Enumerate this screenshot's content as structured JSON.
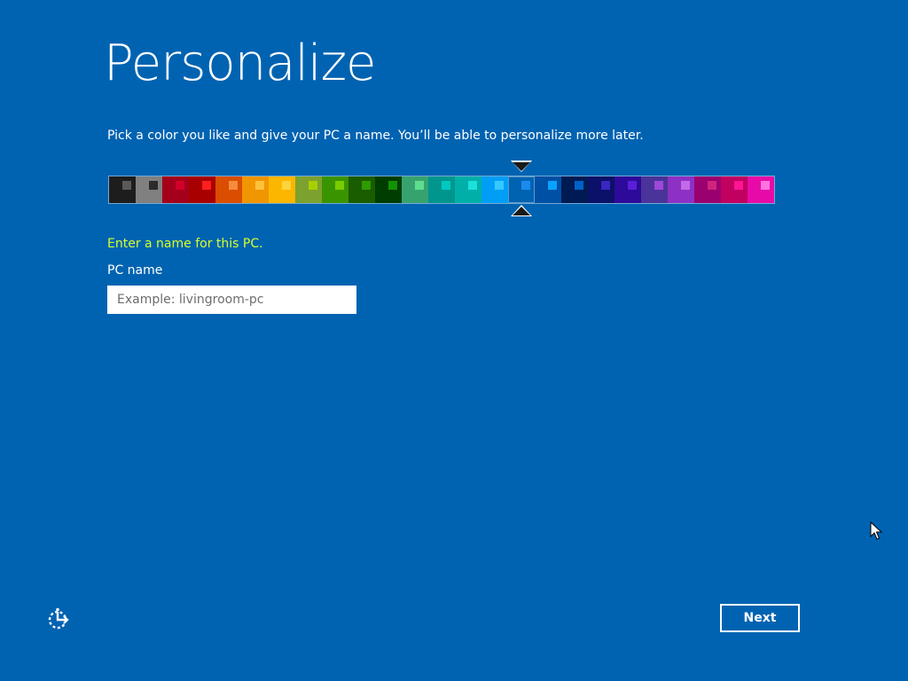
{
  "page": {
    "title": "Personalize",
    "subtitle": "Pick a color you like and give your PC a name. You’ll be able to personalize more later.",
    "background_color": "#0063b1"
  },
  "color_picker": {
    "selected_index": 15,
    "swatches": [
      {
        "bg": "#1d1d1d",
        "chip": "#5a5a5a"
      },
      {
        "bg": "#808080",
        "chip": "#2b2b2b"
      },
      {
        "bg": "#a4001b",
        "chip": "#d1002a"
      },
      {
        "bg": "#a80000",
        "chip": "#ff1f1f"
      },
      {
        "bg": "#d94e00",
        "chip": "#f68b3d"
      },
      {
        "bg": "#f09600",
        "chip": "#fcc23b"
      },
      {
        "bg": "#fbb600",
        "chip": "#fcd43b"
      },
      {
        "bg": "#7da12e",
        "chip": "#a7cf00"
      },
      {
        "bg": "#3a9400",
        "chip": "#78cc00"
      },
      {
        "bg": "#1a5c00",
        "chip": "#2f9b00"
      },
      {
        "bg": "#003d00",
        "chip": "#119400"
      },
      {
        "bg": "#36a36f",
        "chip": "#5fde8f"
      },
      {
        "bg": "#00968d",
        "chip": "#00c9c2"
      },
      {
        "bg": "#00b0a8",
        "chip": "#1ee0da"
      },
      {
        "bg": "#019ef6",
        "chip": "#38c8ff"
      },
      {
        "bg": "#0063b1",
        "chip": "#1a8cee"
      },
      {
        "bg": "#0050a5",
        "chip": "#0aa2ff"
      },
      {
        "bg": "#001a53",
        "chip": "#0062c8"
      },
      {
        "bg": "#0b1068",
        "chip": "#3a26c2"
      },
      {
        "bg": "#2d0a99",
        "chip": "#5a1ed8"
      },
      {
        "bg": "#4a3399",
        "chip": "#9e47d8"
      },
      {
        "bg": "#8d30c4",
        "chip": "#c06be8"
      },
      {
        "bg": "#9a0070",
        "chip": "#d1237d"
      },
      {
        "bg": "#c10060",
        "chip": "#ff1493"
      },
      {
        "bg": "#e70aa8",
        "chip": "#ff73de"
      }
    ]
  },
  "name_section": {
    "prompt": "Enter a name for this PC.",
    "prompt_color": "#d7ff2b",
    "label": "PC name",
    "input_value": "",
    "input_placeholder": "Example: livingroom-pc"
  },
  "footer": {
    "ease_of_access_icon": "ease-of-access-icon",
    "next_label": "Next",
    "next_color": "#0063b1"
  },
  "pointer": {
    "icon": "mouse-pointer-icon"
  }
}
